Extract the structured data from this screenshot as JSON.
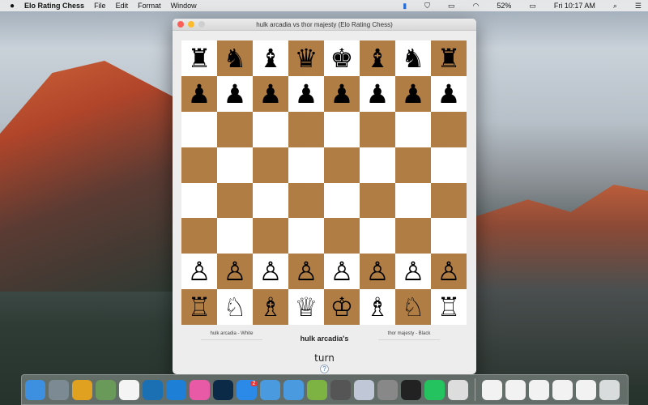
{
  "menubar": {
    "app": "Elo Rating Chess",
    "items": [
      "File",
      "Edit",
      "Format",
      "Window"
    ],
    "battery": "52%",
    "clock": "Fri 10:17 AM"
  },
  "window": {
    "title": "hulk arcadia vs thor majesty (Elo Rating Chess)"
  },
  "board": {
    "light_color": "#ffffff",
    "dark_color": "#b07d45",
    "rows": [
      [
        "♜",
        "♞",
        "♝",
        "♛",
        "♚",
        "♝",
        "♞",
        "♜"
      ],
      [
        "♟",
        "♟",
        "♟",
        "♟",
        "♟",
        "♟",
        "♟",
        "♟"
      ],
      [
        "",
        "",
        "",
        "",
        "",
        "",
        "",
        ""
      ],
      [
        "",
        "",
        "",
        "",
        "",
        "",
        "",
        ""
      ],
      [
        "",
        "",
        "",
        "",
        "",
        "",
        "",
        ""
      ],
      [
        "",
        "",
        "",
        "",
        "",
        "",
        "",
        ""
      ],
      [
        "♙",
        "♙",
        "♙",
        "♙",
        "♙",
        "♙",
        "♙",
        "♙"
      ],
      [
        "♖",
        "♘",
        "♗",
        "♕",
        "♔",
        "♗",
        "♘",
        "♖"
      ]
    ]
  },
  "players": {
    "white": "hulk arcadia - White",
    "black": "thor majesty - Black",
    "current": "hulk arcadia's",
    "turn": "turn",
    "help": "?"
  },
  "dock": {
    "apps": [
      {
        "name": "finder",
        "color": "#3d8fe0"
      },
      {
        "name": "launchpad",
        "color": "#7b8a93"
      },
      {
        "name": "chrome",
        "color": "#e0a020"
      },
      {
        "name": "globe",
        "color": "#6a9a5a"
      },
      {
        "name": "calendar",
        "color": "#f4f4f4"
      },
      {
        "name": "frame",
        "color": "#1b6fb3"
      },
      {
        "name": "teamviewer",
        "color": "#1e7fd6"
      },
      {
        "name": "itunes",
        "color": "#e85aa5"
      },
      {
        "name": "photoshop",
        "color": "#0b2a48"
      },
      {
        "name": "app-store",
        "color": "#2b8ae8",
        "badge": "2"
      },
      {
        "name": "xcode",
        "color": "#4a9ae0"
      },
      {
        "name": "xcode-beta",
        "color": "#4a9ae0"
      },
      {
        "name": "android-studio",
        "color": "#7cb342"
      },
      {
        "name": "system-preferences",
        "color": "#555"
      },
      {
        "name": "settings",
        "color": "#c0c8d8"
      },
      {
        "name": "keychain",
        "color": "#888"
      },
      {
        "name": "terminal",
        "color": "#222"
      },
      {
        "name": "whatsapp",
        "color": "#25c35f"
      },
      {
        "name": "photo",
        "color": "#ddd"
      }
    ],
    "docs": [
      {
        "name": "document"
      },
      {
        "name": "screenshot-1"
      },
      {
        "name": "screenshot-2"
      },
      {
        "name": "screenshot-3"
      },
      {
        "name": "screenshot-4"
      },
      {
        "name": "trash"
      }
    ]
  }
}
